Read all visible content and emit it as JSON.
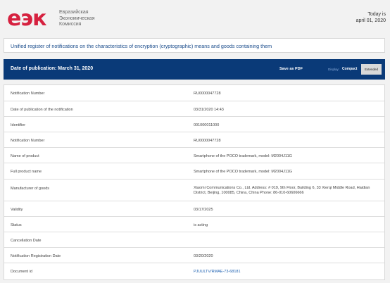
{
  "header": {
    "logo_text": "eэк",
    "org_line1": "Евразийская",
    "org_line2": "Экономическая",
    "org_line3": "Комиссия",
    "today_label": "Today is",
    "today_date": "april 01, 2020"
  },
  "register_title": "Unified register of notifications on the characteristics of encryption (cryptographic) means and goods containing them",
  "bar": {
    "publication_date": "Date of publication: March 31, 2020",
    "save_pdf": "Save as PDF",
    "display_label": "Display:",
    "compact": "Compact",
    "extended": "Extended"
  },
  "rows": [
    {
      "label": "Notification Number",
      "value": "RU0000047728"
    },
    {
      "label": "Date of publication of the notification",
      "value": "03/31/2020 14:43"
    },
    {
      "label": "Identifier",
      "value": "001000011000"
    },
    {
      "label": "Notification Number",
      "value": "RU0000047728"
    },
    {
      "label": "Name of product",
      "value": "Smartphone of the POCO trademark, model: M2004J11G"
    },
    {
      "label": "Full product name",
      "value": "Smartphone of the POCO trademark, model: M2004J11G"
    },
    {
      "label": "Manufacturer of goods",
      "value": "Xiaomi Communications Co., Ltd. Address: # 019, 9th Floor, Building 6, 33 Xierqi Middle Road, Haidian District, Beijing, 100085, China, China Phone: 86-010-60606666"
    },
    {
      "label": "Validity",
      "value": "03/17/2025"
    },
    {
      "label": "Status",
      "value": "is acting"
    },
    {
      "label": "Cancellation Date",
      "value": ""
    },
    {
      "label": "Notification Registration Date",
      "value": "03/20/2020"
    },
    {
      "label": "Document id",
      "value": "PJUULTV/RMAE-73-68181"
    }
  ]
}
